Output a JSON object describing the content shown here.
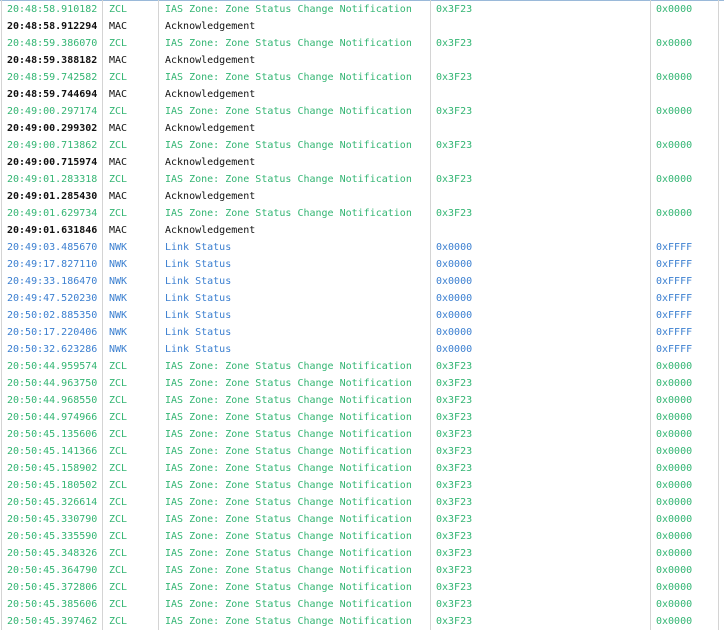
{
  "packets": [
    {
      "time": "20:48:58.910182",
      "layer": "ZCL",
      "description": "IAS Zone: Zone Status Change Notification",
      "src": "0x3F23",
      "dst": "0x0000"
    },
    {
      "time": "20:48:58.912294",
      "layer": "MAC",
      "description": "Acknowledgement",
      "src": "",
      "dst": ""
    },
    {
      "time": "20:48:59.386070",
      "layer": "ZCL",
      "description": "IAS Zone: Zone Status Change Notification",
      "src": "0x3F23",
      "dst": "0x0000"
    },
    {
      "time": "20:48:59.388182",
      "layer": "MAC",
      "description": "Acknowledgement",
      "src": "",
      "dst": ""
    },
    {
      "time": "20:48:59.742582",
      "layer": "ZCL",
      "description": "IAS Zone: Zone Status Change Notification",
      "src": "0x3F23",
      "dst": "0x0000"
    },
    {
      "time": "20:48:59.744694",
      "layer": "MAC",
      "description": "Acknowledgement",
      "src": "",
      "dst": ""
    },
    {
      "time": "20:49:00.297174",
      "layer": "ZCL",
      "description": "IAS Zone: Zone Status Change Notification",
      "src": "0x3F23",
      "dst": "0x0000"
    },
    {
      "time": "20:49:00.299302",
      "layer": "MAC",
      "description": "Acknowledgement",
      "src": "",
      "dst": ""
    },
    {
      "time": "20:49:00.713862",
      "layer": "ZCL",
      "description": "IAS Zone: Zone Status Change Notification",
      "src": "0x3F23",
      "dst": "0x0000"
    },
    {
      "time": "20:49:00.715974",
      "layer": "MAC",
      "description": "Acknowledgement",
      "src": "",
      "dst": ""
    },
    {
      "time": "20:49:01.283318",
      "layer": "ZCL",
      "description": "IAS Zone: Zone Status Change Notification",
      "src": "0x3F23",
      "dst": "0x0000"
    },
    {
      "time": "20:49:01.285430",
      "layer": "MAC",
      "description": "Acknowledgement",
      "src": "",
      "dst": ""
    },
    {
      "time": "20:49:01.629734",
      "layer": "ZCL",
      "description": "IAS Zone: Zone Status Change Notification",
      "src": "0x3F23",
      "dst": "0x0000"
    },
    {
      "time": "20:49:01.631846",
      "layer": "MAC",
      "description": "Acknowledgement",
      "src": "",
      "dst": ""
    },
    {
      "time": "20:49:03.485670",
      "layer": "NWK",
      "description": "Link Status",
      "src": "0x0000",
      "dst": "0xFFFF"
    },
    {
      "time": "20:49:17.827110",
      "layer": "NWK",
      "description": "Link Status",
      "src": "0x0000",
      "dst": "0xFFFF"
    },
    {
      "time": "20:49:33.186470",
      "layer": "NWK",
      "description": "Link Status",
      "src": "0x0000",
      "dst": "0xFFFF"
    },
    {
      "time": "20:49:47.520230",
      "layer": "NWK",
      "description": "Link Status",
      "src": "0x0000",
      "dst": "0xFFFF"
    },
    {
      "time": "20:50:02.885350",
      "layer": "NWK",
      "description": "Link Status",
      "src": "0x0000",
      "dst": "0xFFFF"
    },
    {
      "time": "20:50:17.220406",
      "layer": "NWK",
      "description": "Link Status",
      "src": "0x0000",
      "dst": "0xFFFF"
    },
    {
      "time": "20:50:32.623286",
      "layer": "NWK",
      "description": "Link Status",
      "src": "0x0000",
      "dst": "0xFFFF"
    },
    {
      "time": "20:50:44.959574",
      "layer": "ZCL",
      "description": "IAS Zone: Zone Status Change Notification",
      "src": "0x3F23",
      "dst": "0x0000"
    },
    {
      "time": "20:50:44.963750",
      "layer": "ZCL",
      "description": "IAS Zone: Zone Status Change Notification",
      "src": "0x3F23",
      "dst": "0x0000"
    },
    {
      "time": "20:50:44.968550",
      "layer": "ZCL",
      "description": "IAS Zone: Zone Status Change Notification",
      "src": "0x3F23",
      "dst": "0x0000"
    },
    {
      "time": "20:50:44.974966",
      "layer": "ZCL",
      "description": "IAS Zone: Zone Status Change Notification",
      "src": "0x3F23",
      "dst": "0x0000"
    },
    {
      "time": "20:50:45.135606",
      "layer": "ZCL",
      "description": "IAS Zone: Zone Status Change Notification",
      "src": "0x3F23",
      "dst": "0x0000"
    },
    {
      "time": "20:50:45.141366",
      "layer": "ZCL",
      "description": "IAS Zone: Zone Status Change Notification",
      "src": "0x3F23",
      "dst": "0x0000"
    },
    {
      "time": "20:50:45.158902",
      "layer": "ZCL",
      "description": "IAS Zone: Zone Status Change Notification",
      "src": "0x3F23",
      "dst": "0x0000"
    },
    {
      "time": "20:50:45.180502",
      "layer": "ZCL",
      "description": "IAS Zone: Zone Status Change Notification",
      "src": "0x3F23",
      "dst": "0x0000"
    },
    {
      "time": "20:50:45.326614",
      "layer": "ZCL",
      "description": "IAS Zone: Zone Status Change Notification",
      "src": "0x3F23",
      "dst": "0x0000"
    },
    {
      "time": "20:50:45.330790",
      "layer": "ZCL",
      "description": "IAS Zone: Zone Status Change Notification",
      "src": "0x3F23",
      "dst": "0x0000"
    },
    {
      "time": "20:50:45.335590",
      "layer": "ZCL",
      "description": "IAS Zone: Zone Status Change Notification",
      "src": "0x3F23",
      "dst": "0x0000"
    },
    {
      "time": "20:50:45.348326",
      "layer": "ZCL",
      "description": "IAS Zone: Zone Status Change Notification",
      "src": "0x3F23",
      "dst": "0x0000"
    },
    {
      "time": "20:50:45.364790",
      "layer": "ZCL",
      "description": "IAS Zone: Zone Status Change Notification",
      "src": "0x3F23",
      "dst": "0x0000"
    },
    {
      "time": "20:50:45.372806",
      "layer": "ZCL",
      "description": "IAS Zone: Zone Status Change Notification",
      "src": "0x3F23",
      "dst": "0x0000"
    },
    {
      "time": "20:50:45.385606",
      "layer": "ZCL",
      "description": "IAS Zone: Zone Status Change Notification",
      "src": "0x3F23",
      "dst": "0x0000"
    },
    {
      "time": "20:50:45.397462",
      "layer": "ZCL",
      "description": "IAS Zone: Zone Status Change Notification",
      "src": "0x3F23",
      "dst": "0x0000"
    }
  ],
  "colors": {
    "ZCL": "#33b573",
    "MAC": "#111111",
    "NWK": "#3b7fd0"
  }
}
